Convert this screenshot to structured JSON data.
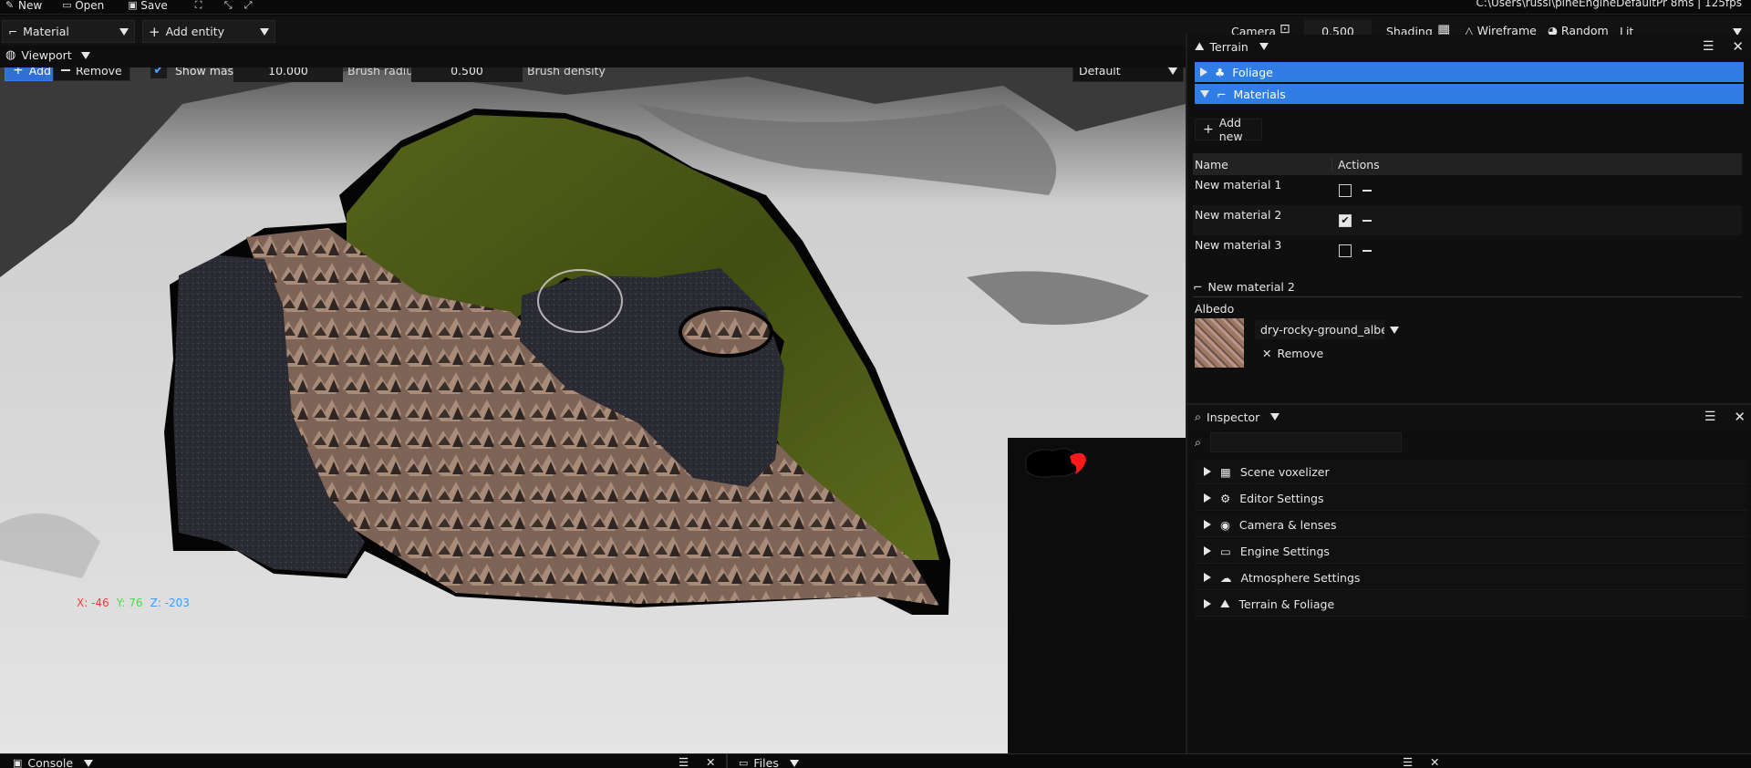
{
  "menubar": {
    "items": [
      {
        "label": "New",
        "icon": "new-file-icon"
      },
      {
        "label": "Open",
        "icon": "folder-icon"
      },
      {
        "label": "Save",
        "icon": "save-icon"
      }
    ],
    "status": "C:\\Users\\russi\\pineEngineDefaultPr  8ms | 125fps"
  },
  "toolbar": {
    "material_label": "Material",
    "add_entity_label": "Add entity",
    "camera_label": "Camera",
    "camera_value": "0.500",
    "shading_label": "Shading",
    "wireframe_label": "Wireframe",
    "random_label": "Random",
    "lit_label": "Lit"
  },
  "viewport": {
    "tab_label": "Viewport",
    "add_label": "Add",
    "remove_label": "Remove",
    "show_mask_label": "Show mask",
    "show_mask_checked": true,
    "brush_radius_value": "10.000",
    "brush_radius_label": "Brush radius",
    "brush_density_value": "0.500",
    "brush_density_label": "Brush density",
    "mode_value": "Default",
    "coords": {
      "x": "X: -46",
      "y": "Y: 76",
      "z": "Z: -203"
    }
  },
  "terrain_panel": {
    "title": "Terrain",
    "foliage_label": "Foliage",
    "materials_label": "Materials",
    "add_new_label": "Add new",
    "table": {
      "headers": [
        "Name",
        "Actions"
      ],
      "rows": [
        {
          "name": "New material 1",
          "checked": false
        },
        {
          "name": "New material 2",
          "checked": true
        },
        {
          "name": "New material 3",
          "checked": false
        }
      ]
    },
    "selected_material_title": "New material 2",
    "albedo_label": "Albedo",
    "albedo_file": "dry-rocky-ground_albed",
    "albedo_remove_label": "Remove"
  },
  "inspector": {
    "title": "Inspector",
    "search_value": "",
    "items": [
      {
        "label": "Scene voxelizer",
        "icon": "grid-icon"
      },
      {
        "label": "Editor Settings",
        "icon": "gear-icon"
      },
      {
        "label": "Camera & lenses",
        "icon": "aperture-icon"
      },
      {
        "label": "Engine Settings",
        "icon": "monitor-icon"
      },
      {
        "label": "Atmosphere Settings",
        "icon": "weather-icon"
      },
      {
        "label": "Terrain & Foliage",
        "icon": "mountain-icon"
      }
    ]
  },
  "bottom": {
    "console_label": "Console",
    "files_label": "Files"
  },
  "colors": {
    "accent": "#2f7ee6",
    "grass": "#4f5a16",
    "rock_dark": "#2c2c34",
    "rock_brown": "#8a6a58",
    "coord_x": "#ff3b3b",
    "coord_y": "#46e046",
    "coord_z": "#3a9bff"
  }
}
